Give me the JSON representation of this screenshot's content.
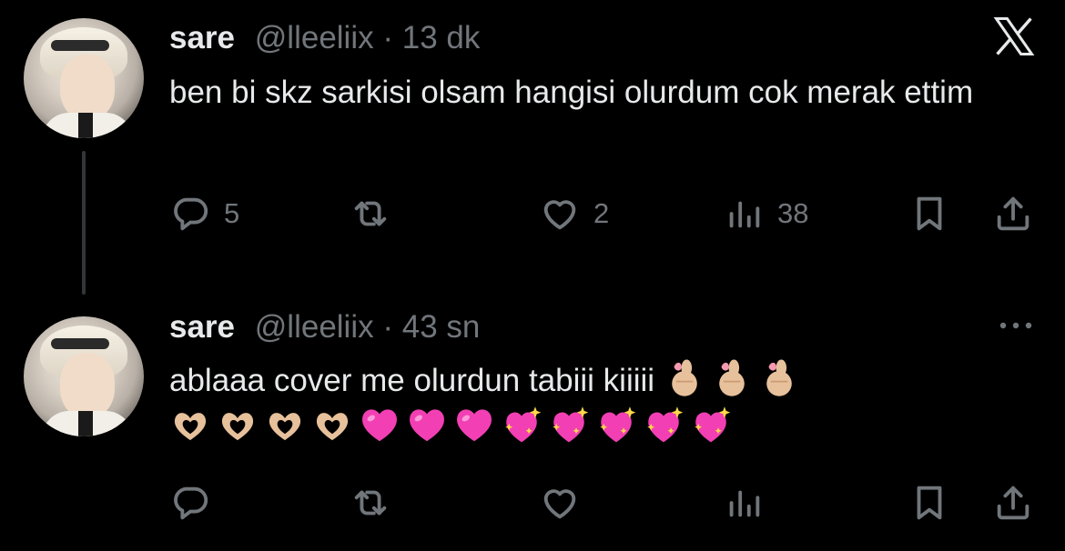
{
  "tweets": [
    {
      "author": {
        "name": "sare",
        "handle": "@lleeliix"
      },
      "separator": "·",
      "time": "13 dk",
      "text": "ben bi skz sarkisi olsam hangisi olurdum cok merak ettim",
      "emojis": [],
      "stats": {
        "replies": "5",
        "retweets": "",
        "likes": "2",
        "views": "38"
      }
    },
    {
      "author": {
        "name": "sare",
        "handle": "@lleeliix"
      },
      "separator": "·",
      "time": "43 sn",
      "text": "ablaaa cover me olurdun tabiii kiiiii",
      "emojis": [
        "finger-heart",
        "finger-heart",
        "finger-heart",
        "heart-hands",
        "heart-hands",
        "heart-hands",
        "heart-hands",
        "pink-heart",
        "pink-heart",
        "pink-heart",
        "sparkling-heart",
        "sparkling-heart",
        "sparkling-heart",
        "sparkling-heart",
        "sparkling-heart"
      ],
      "stats": {
        "replies": "",
        "retweets": "",
        "likes": "",
        "views": ""
      }
    }
  ],
  "icons": {
    "close": "x-logo-icon",
    "more": "more-dots-icon",
    "reply": "reply-bubble-icon",
    "retweet": "retweet-icon",
    "like": "heart-outline-icon",
    "views": "views-bar-icon",
    "bookmark": "bookmark-icon",
    "share": "share-icon"
  },
  "colors": {
    "background": "#000000",
    "text": "#e7e9ea",
    "muted": "#71767b",
    "thread_line": "#333639"
  }
}
